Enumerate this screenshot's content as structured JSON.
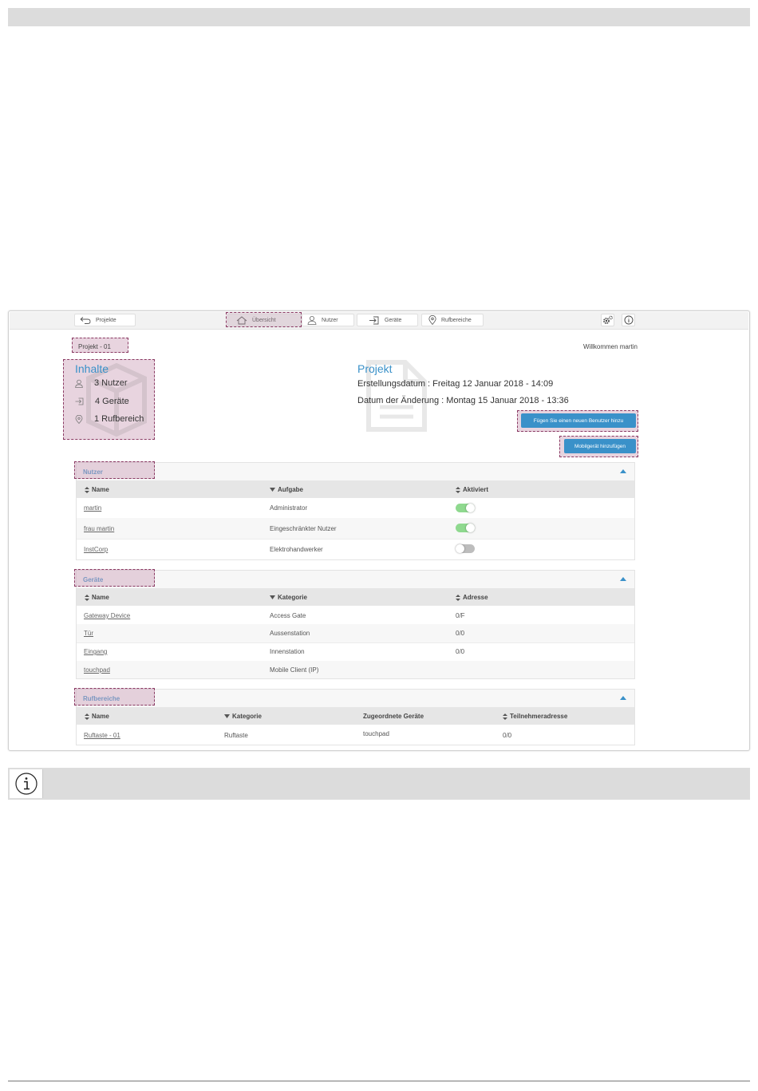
{
  "nav": {
    "projects": "Projekte",
    "overview": "Übersicht",
    "users": "Nutzer",
    "devices": "Geräte",
    "callzones": "Rufbereiche"
  },
  "project_name": "Projekt - 01",
  "welcome": "Willkommen martin",
  "contents": {
    "title": "Inhalte",
    "users": "3 Nutzer",
    "devices": "4 Geräte",
    "callzones": "1 Rufbereich"
  },
  "project": {
    "title": "Projekt",
    "created": "Erstellungsdatum : Freitag 12 Januar 2018 - 14:09",
    "modified": "Datum der Änderung : Montag 15 Januar 2018 - 13:36",
    "add_user": "Fügen Sie einen neuen Benutzer hinzu",
    "add_mobile": "Mobilgerät hinzufügen"
  },
  "users_section": {
    "title": "Nutzer",
    "headers": [
      "Name",
      "Aufgabe",
      "Aktiviert"
    ],
    "rows": [
      {
        "name": "martin",
        "role": "Administrator",
        "active": true
      },
      {
        "name": "frau martin",
        "role": "Eingeschränkter Nutzer",
        "active": true
      },
      {
        "name": "InstCorp",
        "role": "Elektrohandwerker",
        "active": false
      }
    ]
  },
  "devices_section": {
    "title": "Geräte",
    "headers": [
      "Name",
      "Kategorie",
      "Adresse"
    ],
    "rows": [
      {
        "name": "Gateway Device",
        "category": "Access Gate",
        "address": "0/F"
      },
      {
        "name": "Tür",
        "category": "Aussenstation",
        "address": "0/0"
      },
      {
        "name": "Eingang",
        "category": "Innenstation",
        "address": "0/0"
      },
      {
        "name": "touchpad",
        "category": "Mobile Client (IP)",
        "address": ""
      }
    ]
  },
  "callzones_section": {
    "title": "Rufbereiche",
    "headers": [
      "Name",
      "Kategorie",
      "Zugeordnete Geräte",
      "Teilnehmeradresse"
    ],
    "rows": [
      {
        "name": "Ruftaste - 01",
        "category": "Ruftaste",
        "devices": "touchpad",
        "address": "0/0"
      }
    ]
  },
  "colors": {
    "accent": "#3a91c9",
    "highlight": "#cda0b9",
    "toggle_on": "#8fd98f",
    "toggle_off": "#bdbdbd"
  }
}
